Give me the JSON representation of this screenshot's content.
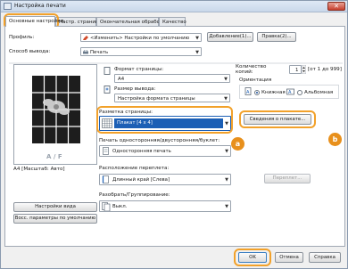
{
  "window": {
    "title": "Настройка печати",
    "close_glyph": "✕"
  },
  "tabs": [
    {
      "label": "Основные настройки",
      "active": true
    },
    {
      "label": "Настр. страницы",
      "active": false
    },
    {
      "label": "Окончательная обработка",
      "active": false
    },
    {
      "label": "Качество",
      "active": false
    }
  ],
  "profile": {
    "label": "Профиль:",
    "value": "<Изменить> Настройки по умолчанию",
    "add_button": "Добавление(1)...",
    "edit_button": "Правка(2)..."
  },
  "output_method": {
    "label": "Способ вывода:",
    "value": "Печать"
  },
  "page_size": {
    "label": "Формат страницы:",
    "value": "A4"
  },
  "output_size": {
    "label": "Размер вывода:",
    "value": "Настройка формата страницы"
  },
  "copies": {
    "label": "Количество копий:",
    "value": "1",
    "range": "[от 1 до 999]"
  },
  "orientation": {
    "label": "Ориентация",
    "portrait": "Книжная",
    "landscape": "Альбомная",
    "selected": "portrait"
  },
  "page_layout": {
    "label": "Разметка страницы:",
    "value": "Плакат [4 x 4]"
  },
  "poster_details_button": "Сведения о плакате...",
  "duplex": {
    "label": "Печать односторонняя/двусторонняя/буклет:",
    "value": "Односторонняя печать"
  },
  "binding": {
    "label": "Расположение переплета:",
    "value": "Длинный край [Слева]",
    "button": "Переплет..."
  },
  "collate": {
    "label": "Разобрать/Группирование:",
    "value": "Выкл."
  },
  "preview": {
    "caption": "A4 [Масштаб: Авто]",
    "badge": "A / F"
  },
  "left_buttons": {
    "view_settings": "Настройки вида",
    "restore_defaults": "Восс. параметры по умолчанию"
  },
  "footer": {
    "ok": "OK",
    "cancel": "Отмена",
    "help": "Справка"
  },
  "callouts": {
    "a": "a",
    "b": "b"
  },
  "colors": {
    "highlight": "#f2a12a",
    "callout": "#e8901c",
    "selection": "#1c5fb5"
  }
}
